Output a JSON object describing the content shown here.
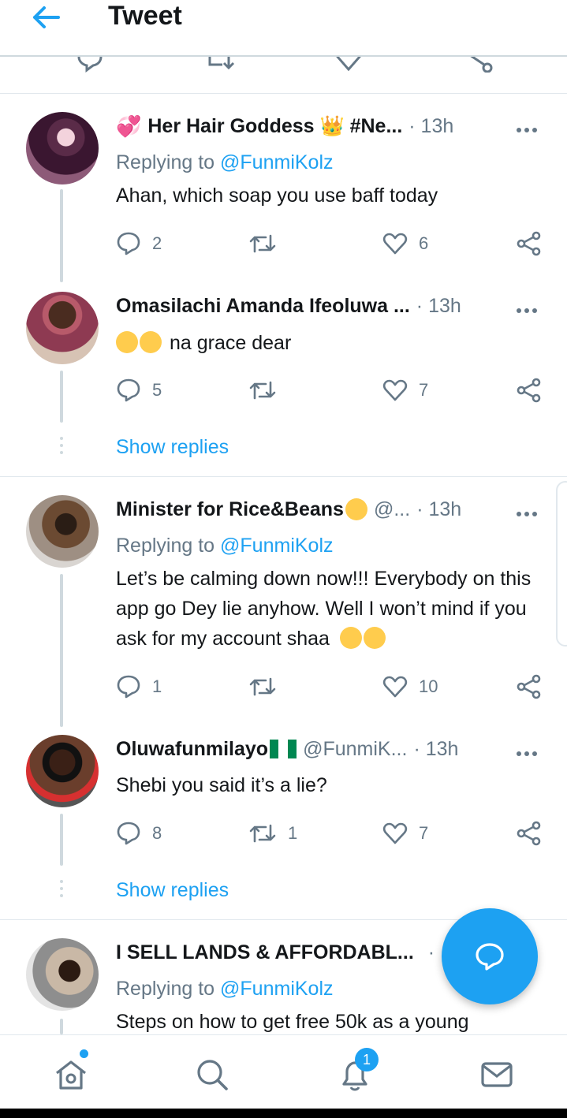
{
  "header": {
    "title": "Tweet"
  },
  "tweets": [
    {
      "name": "Her Hair Goddess 👑 #Ne...",
      "handle": "",
      "time": "· 13h",
      "replying_label": "Replying to",
      "replying_to": "@FunmiKolz",
      "text": "Ahan, which soap you use baff today",
      "replies": "2",
      "retweets": "",
      "likes": "6"
    },
    {
      "name": "Omasilachi Amanda Ifeoluwa ...",
      "handle": "",
      "time": "· 13h",
      "text": "na grace dear",
      "replies": "5",
      "retweets": "",
      "likes": "7"
    },
    {
      "name": "Minister for Rice&Beans",
      "handle": "@...",
      "time": "· 13h",
      "replying_label": "Replying to",
      "replying_to": "@FunmiKolz",
      "text": "Let’s be calming down now!!! Everybody on this app go Dey lie anyhow. Well I won’t mind if you ask for my account shaa",
      "replies": "1",
      "retweets": "",
      "likes": "10"
    },
    {
      "name": "Oluwafunmilayo",
      "handle": "@FunmiK...",
      "time": "· 13h",
      "text": "Shebi you said it’s a lie?",
      "replies": "8",
      "retweets": "1",
      "likes": "7"
    },
    {
      "name": "I SELL LANDS & AFFORDABL...",
      "handle": "",
      "time": "·",
      "replying_label": "Replying to",
      "replying_to": "@FunmiKolz",
      "text": "Steps on how to get free 50k as a young"
    }
  ],
  "show_replies_label": "Show replies",
  "nav": {
    "notifications_badge": "1"
  },
  "colors": {
    "accent": "#1da1f2",
    "muted": "#657786",
    "text": "#14171a"
  },
  "icons": [
    "back-arrow-icon",
    "more-icon",
    "reply-icon",
    "retweet-icon",
    "like-icon",
    "share-icon",
    "compose-icon",
    "home-icon",
    "search-icon",
    "notifications-icon",
    "messages-icon"
  ]
}
